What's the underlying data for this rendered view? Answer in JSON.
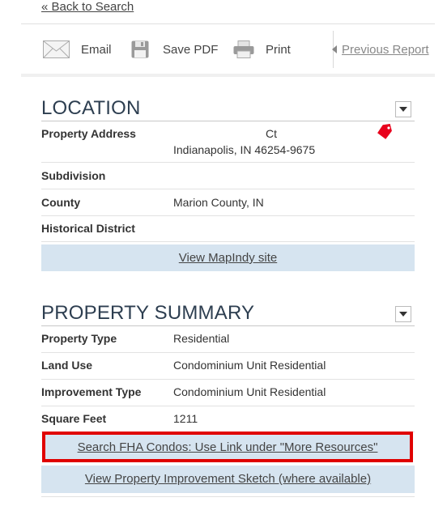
{
  "nav": {
    "back_label": "« Back to Search"
  },
  "toolbar": {
    "email_label": "Email",
    "save_pdf_label": "Save PDF",
    "print_label": "Print",
    "previous_label": "Previous Report"
  },
  "location": {
    "title": "LOCATION",
    "rows": [
      {
        "key": "Property Address",
        "line1": "Ct",
        "line2": "Indianapolis, IN 46254-9675"
      },
      {
        "key": "Subdivision",
        "value": ""
      },
      {
        "key": "County",
        "value": "Marion County, IN"
      },
      {
        "key": "Historical District",
        "value": ""
      }
    ],
    "map_link": "View MapIndy site"
  },
  "summary": {
    "title": "PROPERTY SUMMARY",
    "rows": [
      {
        "key": "Property Type",
        "value": "Residential"
      },
      {
        "key": "Land Use",
        "value": "Condominium Unit Residential"
      },
      {
        "key": "Improvement Type",
        "value": "Condominium Unit Residential"
      },
      {
        "key": "Square Feet",
        "value": "1211"
      }
    ],
    "fha_link": "Search FHA Condos: Use Link under \"More Resources\"",
    "sketch_link": "View Property Improvement Sketch (where available)"
  },
  "colors": {
    "title": "#2d3e50",
    "band": "#d6e4f0",
    "highlight": "#e00000",
    "tag": "#e8001c"
  }
}
